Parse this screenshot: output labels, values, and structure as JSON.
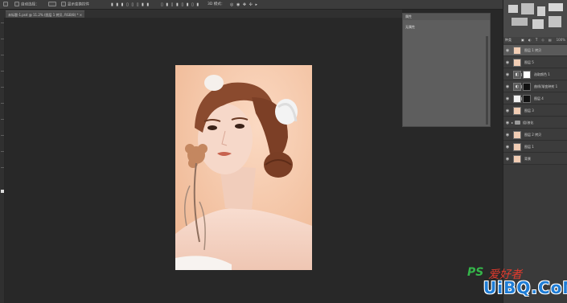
{
  "options_bar": {
    "auto_select_label": "自动选择：",
    "transform_controls_label": "显示变换控件",
    "mode_3d_label": "3D 模式："
  },
  "document_tab": {
    "title": "未标题-1.psd @ 11.2% (图层 1 拷贝, RGB/8) *"
  },
  "properties_panel": {
    "title": "属性",
    "content": "无属性"
  },
  "layers_panel": {
    "kind_label": "种类",
    "opacity_value": "100%",
    "layers": [
      {
        "name": "图层 1 拷贝",
        "type": "pixel",
        "selected": true
      },
      {
        "name": "图层 5",
        "type": "pixel",
        "selected": false
      },
      {
        "name": "选取颜色 1",
        "type": "adjustment",
        "adjustment_glyph": "◧",
        "selected": false
      },
      {
        "name": "曲线/渐变映射 1",
        "type": "adjustment",
        "adjustment_glyph": "◐",
        "selected": false
      },
      {
        "name": "图层 4",
        "type": "masked",
        "selected": false
      },
      {
        "name": "图层 3",
        "type": "pixel",
        "selected": false
      },
      {
        "name": "组/液化",
        "type": "group",
        "selected": false
      },
      {
        "name": "图层 2 拷贝",
        "type": "pixel",
        "selected": false
      },
      {
        "name": "图层 1",
        "type": "pixel",
        "selected": false
      },
      {
        "name": "背景",
        "type": "background",
        "selected": false
      }
    ]
  },
  "watermark": {
    "ps_text": "PS",
    "cn_text": "爱好者",
    "logo_text": "UiBQ.CoM"
  },
  "colors": {
    "canvas_bg": "#282828",
    "panel_bg": "#3a3a3a",
    "skin_bg": "#f3c4a6",
    "hair": "#8a4a2e",
    "watermark_green": "#35b54a",
    "watermark_red": "#e33b2e",
    "watermark_blue": "#1f7dd6"
  }
}
